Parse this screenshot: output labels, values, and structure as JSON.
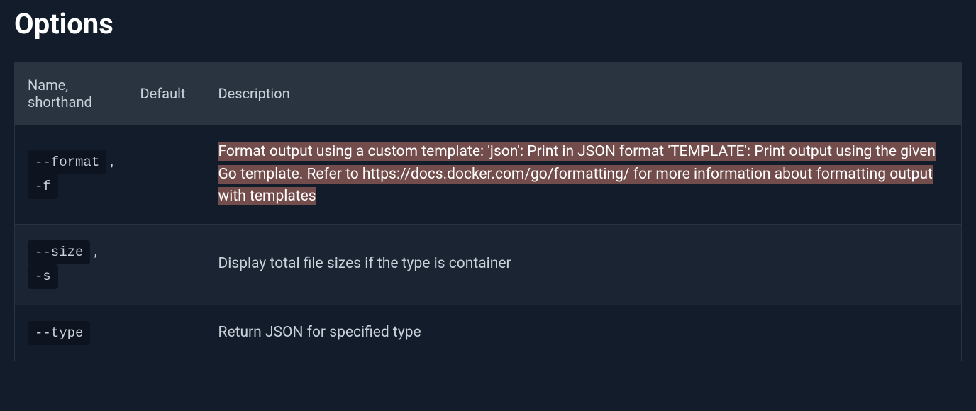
{
  "heading": "Options",
  "table": {
    "headers": {
      "name": "Name, shorthand",
      "default": "Default",
      "description": "Description"
    },
    "rows": [
      {
        "name": "--format",
        "shorthand": "-f",
        "default": "",
        "description": "Format output using a custom template: 'json': Print in JSON format 'TEMPLATE': Print output using the given Go template. Refer to https://docs.docker.com/go/formatting/ for more information about formatting output with templates",
        "highlighted": true
      },
      {
        "name": "--size",
        "shorthand": "-s",
        "default": "",
        "description": "Display total file sizes if the type is container",
        "highlighted": false
      },
      {
        "name": "--type",
        "shorthand": "",
        "default": "",
        "description": "Return JSON for specified type",
        "highlighted": false
      }
    ]
  }
}
